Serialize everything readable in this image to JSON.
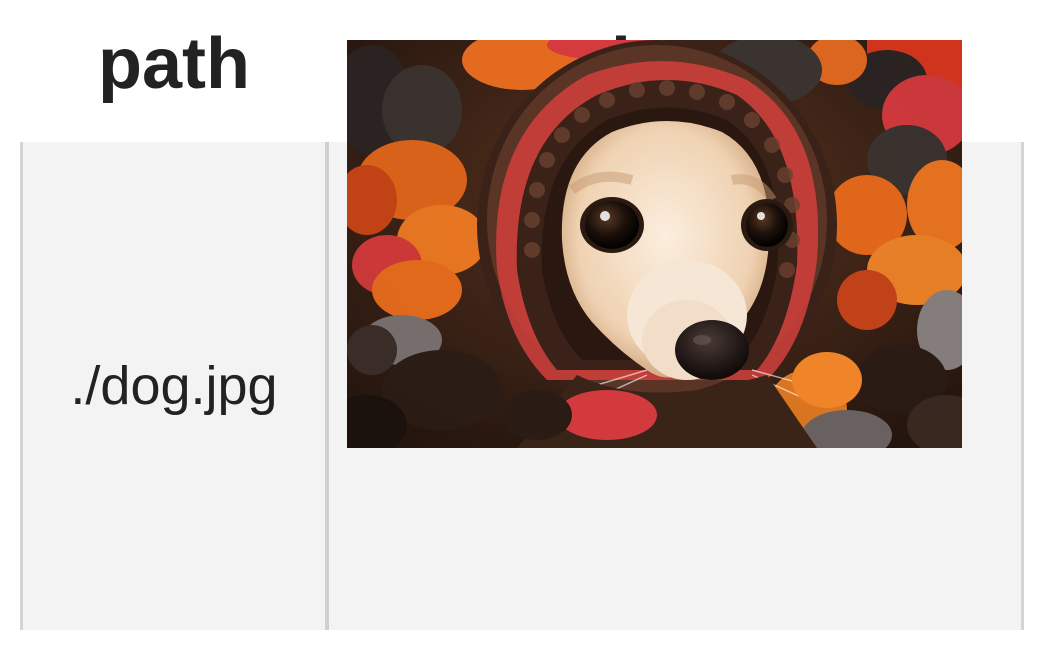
{
  "table": {
    "headers": [
      "path",
      "img"
    ],
    "rows": [
      {
        "path": "./dog.jpg",
        "img_alt": "dog-photo"
      }
    ]
  },
  "colors": {
    "header_text": "#222222",
    "cell_background": "#f3f3f3",
    "cell_border": "#d0d0d0"
  }
}
